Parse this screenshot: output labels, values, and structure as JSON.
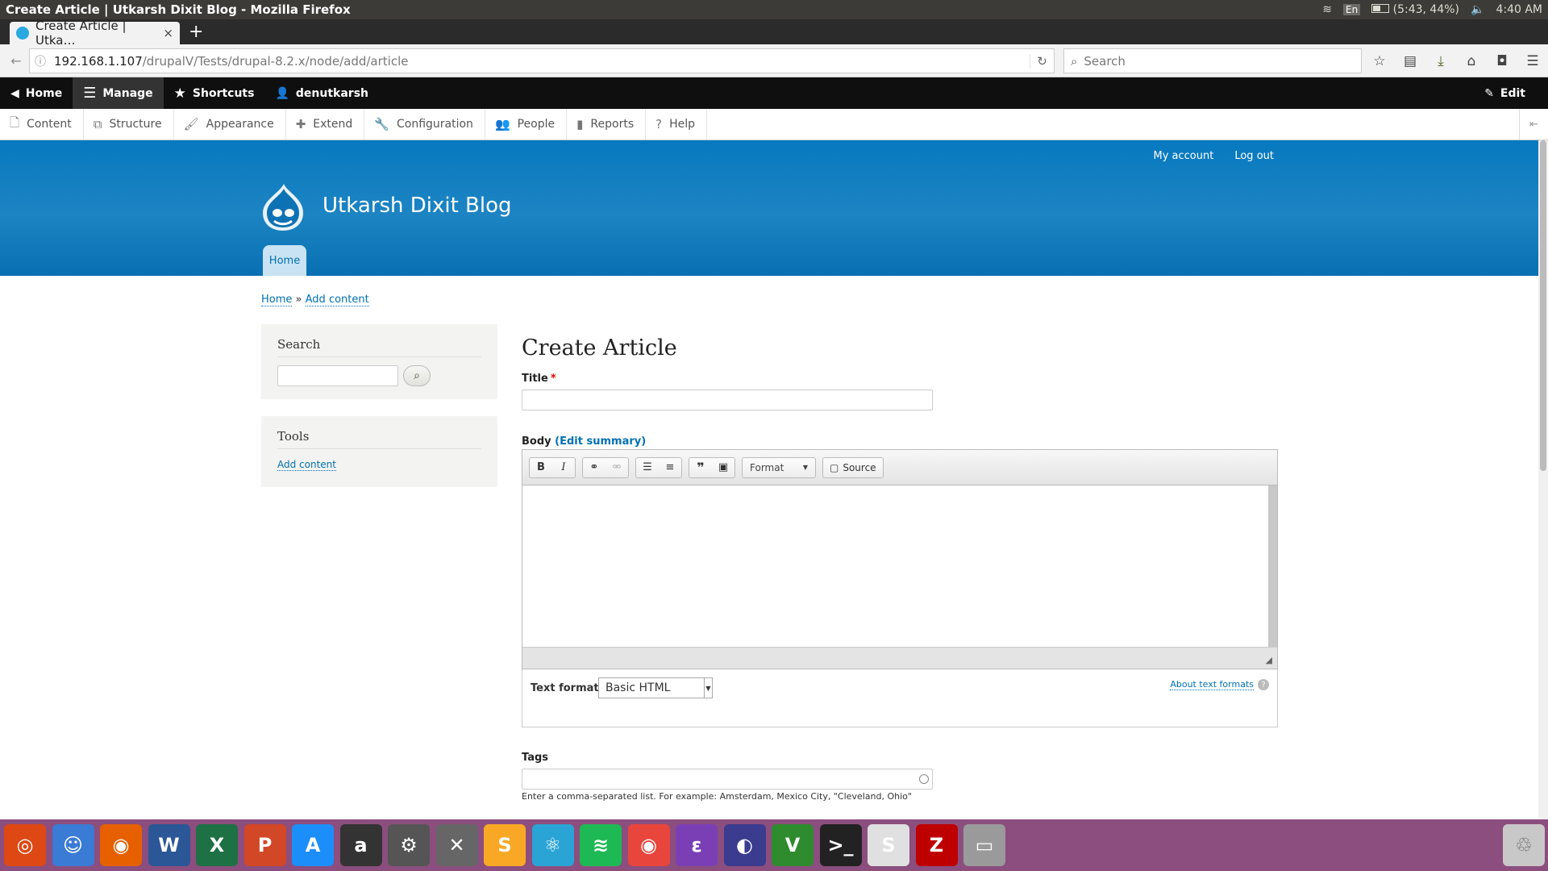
{
  "system_bar": {
    "window_title": "Create Article | Utkarsh Dixit Blog - Mozilla Firefox",
    "keyboard": "En",
    "battery": "(5:43, 44%)",
    "clock": "4:40 AM"
  },
  "browser": {
    "tab_title": "Create Article | Utka…",
    "tab_close": "×",
    "new_tab": "+",
    "url_host": "192.168.1.107",
    "url_path": "/drupalV/Tests/drupal-8.2.x/node/add/article",
    "search_placeholder": "Search"
  },
  "admin_toolbar": {
    "items": [
      {
        "label": "Home",
        "icon": "drupal-home-icon"
      },
      {
        "label": "Manage",
        "icon": "hamburger-icon"
      },
      {
        "label": "Shortcuts",
        "icon": "star-icon"
      },
      {
        "label": "denutkarsh",
        "icon": "user-icon"
      }
    ],
    "edit_label": "Edit"
  },
  "admin_tray": {
    "items": [
      {
        "label": "Content",
        "icon": "file-icon"
      },
      {
        "label": "Structure",
        "icon": "sitemap-icon"
      },
      {
        "label": "Appearance",
        "icon": "paintbrush-icon"
      },
      {
        "label": "Extend",
        "icon": "puzzle-icon"
      },
      {
        "label": "Configuration",
        "icon": "wrench-icon"
      },
      {
        "label": "People",
        "icon": "people-icon"
      },
      {
        "label": "Reports",
        "icon": "bar-chart-icon"
      },
      {
        "label": "Help",
        "icon": "help-icon"
      }
    ]
  },
  "site_header": {
    "secondary_menu": [
      "My account",
      "Log out"
    ],
    "site_name": "Utkarsh Dixit Blog",
    "main_tab": "Home",
    "accent": "#0779bf"
  },
  "breadcrumb": {
    "items": [
      "Home",
      "Add content"
    ],
    "separator": "»"
  },
  "sidebar": {
    "search_block_title": "Search",
    "tools_block_title": "Tools",
    "tools_link": "Add content"
  },
  "form": {
    "page_title": "Create Article",
    "title_label": "Title",
    "required_marker": "*",
    "body_label": "Body",
    "edit_summary": "(Edit summary)",
    "format_dropdown": "Format",
    "source_button": "Source",
    "text_format_label": "Text format",
    "text_format_value": "Basic HTML",
    "about_text_formats": "About text formats",
    "tags_label": "Tags",
    "tags_description": "Enter a comma-separated list. For example: Amsterdam, Mexico City, \"Cleveland, Ohio\""
  },
  "dock": {
    "apps": [
      {
        "name": "ubuntu-icon",
        "glyph": "◎",
        "color": "#dd4814"
      },
      {
        "name": "finder-icon",
        "glyph": "☺",
        "color": "#3a7bd5"
      },
      {
        "name": "firefox-icon",
        "glyph": "◉",
        "color": "#e66000"
      },
      {
        "name": "word-icon",
        "glyph": "W",
        "color": "#2b5797"
      },
      {
        "name": "excel-icon",
        "glyph": "X",
        "color": "#1e7145"
      },
      {
        "name": "powerpoint-icon",
        "glyph": "P",
        "color": "#d24726"
      },
      {
        "name": "app-store-icon",
        "glyph": "A",
        "color": "#1c8ef9"
      },
      {
        "name": "amazon-icon",
        "glyph": "a",
        "color": "#333333"
      },
      {
        "name": "system-settings-icon",
        "glyph": "⚙",
        "color": "#555555"
      },
      {
        "name": "tools-icon",
        "glyph": "✕",
        "color": "#666666"
      },
      {
        "name": "sublime-icon",
        "glyph": "S",
        "color": "#f9a825"
      },
      {
        "name": "atom-icon",
        "glyph": "⚛",
        "color": "#2aa4d5"
      },
      {
        "name": "spotify-icon",
        "glyph": "≋",
        "color": "#1db954"
      },
      {
        "name": "chrome-icon",
        "glyph": "◉",
        "color": "#e8453c"
      },
      {
        "name": "emacs-icon",
        "glyph": "ε",
        "color": "#7b3fb5"
      },
      {
        "name": "eclipse-icon",
        "glyph": "◐",
        "color": "#3b3b8f"
      },
      {
        "name": "vim-icon",
        "glyph": "V",
        "color": "#2e8b2e"
      },
      {
        "name": "terminal-icon",
        "glyph": ">_",
        "color": "#222222"
      },
      {
        "name": "slack-icon",
        "glyph": "S",
        "color": "#e0e0e0"
      },
      {
        "name": "filezilla-icon",
        "glyph": "Z",
        "color": "#bf0000"
      },
      {
        "name": "disk-icon",
        "glyph": "▭",
        "color": "#9a9a9a"
      }
    ],
    "trash": {
      "name": "trash-icon",
      "glyph": "♲",
      "color": "#c8c8c8"
    }
  }
}
